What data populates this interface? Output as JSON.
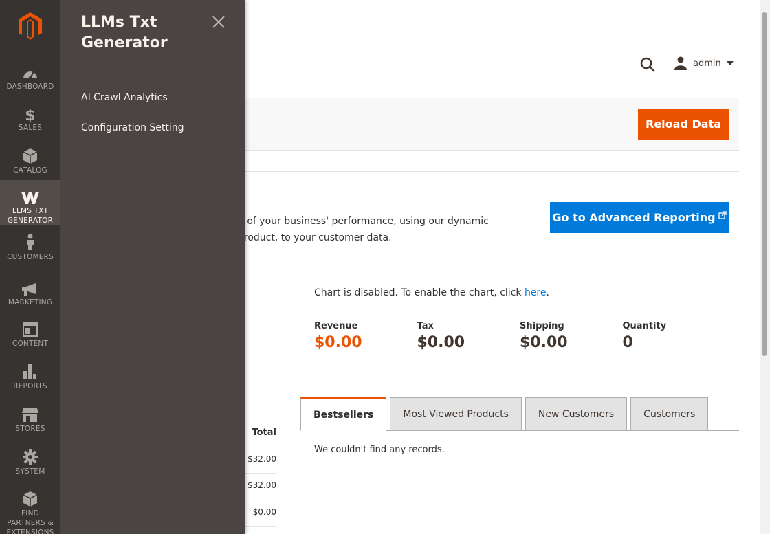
{
  "admin_nav": {
    "items": [
      {
        "label": "DASHBOARD",
        "icon": "dashboard-icon"
      },
      {
        "label": "SALES",
        "icon": "dollar-icon"
      },
      {
        "label": "CATALOG",
        "icon": "box-icon"
      },
      {
        "label": "LLMS TXT GENERATOR",
        "icon": "llms-icon",
        "active": true
      },
      {
        "label": "CUSTOMERS",
        "icon": "person-icon"
      },
      {
        "label": "MARKETING",
        "icon": "megaphone-icon"
      },
      {
        "label": "CONTENT",
        "icon": "layout-icon"
      },
      {
        "label": "REPORTS",
        "icon": "bar-chart-icon"
      },
      {
        "label": "STORES",
        "icon": "storefront-icon"
      },
      {
        "label": "SYSTEM",
        "icon": "gear-icon"
      },
      {
        "label": "FIND PARTNERS & EXTENSIONS",
        "icon": "blocks-icon"
      }
    ],
    "colors": {
      "background": "#373330",
      "active": "#524d49",
      "logo": "#eb5202"
    }
  },
  "submenu": {
    "title": "LLMs Txt Generator",
    "links": [
      "AI Crawl Analytics",
      "Configuration Setting"
    ]
  },
  "header": {
    "user": "admin"
  },
  "actions": {
    "reload_label": "Reload Data"
  },
  "advanced_reporting": {
    "text": "d of your business' performance, using our dynamic product, to your customer data.",
    "button_label": "Go to Advanced Reporting"
  },
  "chart": {
    "message_prefix": "Chart is disabled. To enable the chart, click ",
    "link": "here",
    "message_suffix": "."
  },
  "totals": [
    {
      "label": "Revenue",
      "value": "$0.00"
    },
    {
      "label": "Tax",
      "value": "$0.00"
    },
    {
      "label": "Shipping",
      "value": "$0.00"
    },
    {
      "label": "Quantity",
      "value": "0"
    }
  ],
  "orders_table": {
    "header": "Total",
    "rows": [
      "$32.00",
      "$32.00",
      "$0.00"
    ]
  },
  "tabs": [
    {
      "label": "Bestsellers",
      "active": true
    },
    {
      "label": "Most Viewed Products"
    },
    {
      "label": "New Customers"
    },
    {
      "label": "Customers"
    }
  ],
  "tab_content": {
    "empty_message": "We couldn't find any records."
  },
  "colors": {
    "accent": "#eb5202",
    "primary_blue": "#007bdb"
  }
}
